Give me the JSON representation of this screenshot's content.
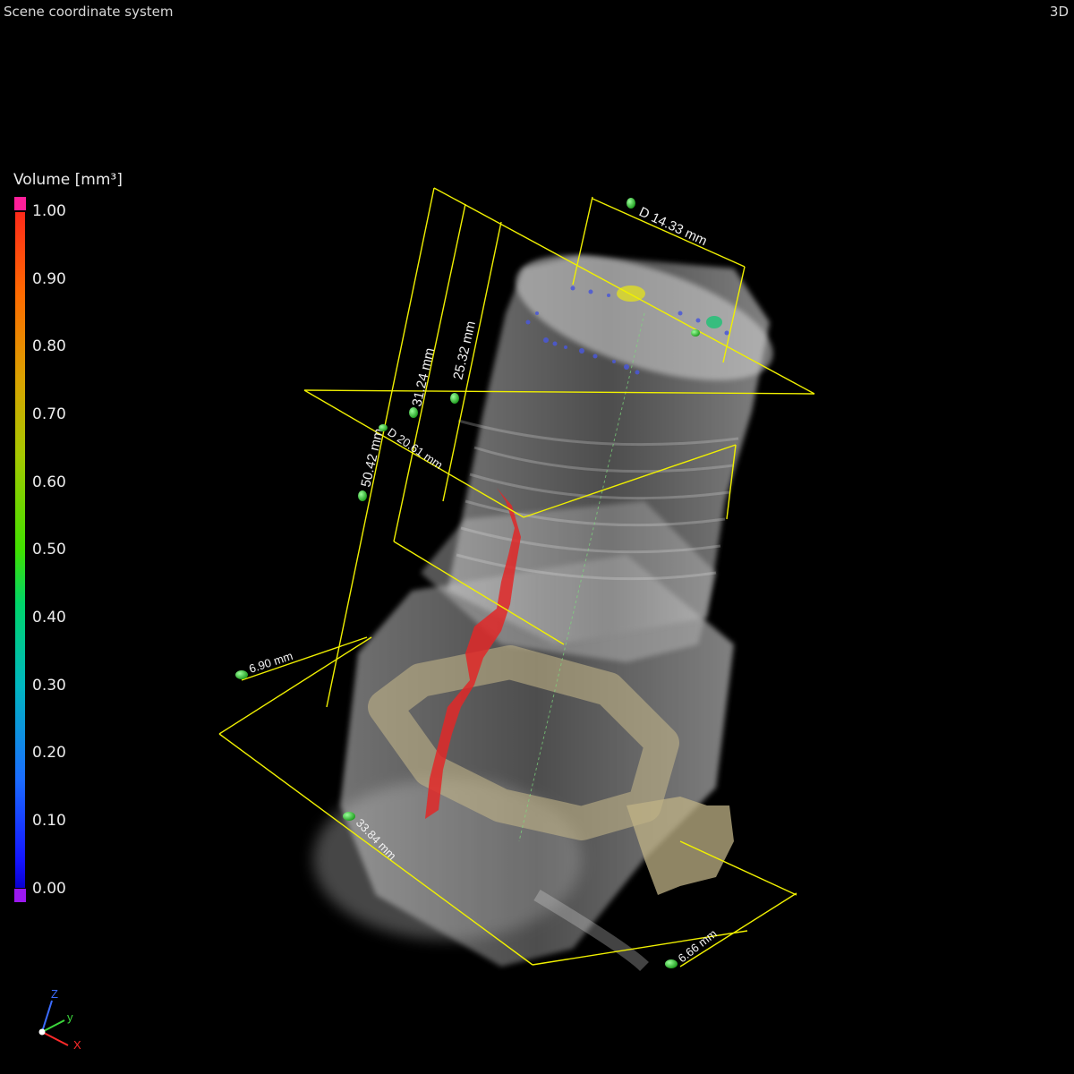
{
  "header": {
    "scene_title": "Scene coordinate system",
    "view_mode": "3D"
  },
  "legend": {
    "title": "Volume [mm³]",
    "ticks": [
      "1.00",
      "0.90",
      "0.80",
      "0.70",
      "0.60",
      "0.50",
      "0.40",
      "0.30",
      "0.20",
      "0.10",
      "0.00"
    ]
  },
  "measurements": {
    "diameter_top": "D 14.33 mm",
    "diameter_mid": "D 20.61 mm",
    "height_total": "50.42 mm",
    "height_mid": "31.24 mm",
    "height_upper": "25.32 mm",
    "width_small": "6.90 mm",
    "width_base": "33.84 mm",
    "clip_width": "6.66 mm"
  },
  "axes": {
    "z": "Z",
    "y": "y",
    "x": "X"
  },
  "colors": {
    "dimension_line": "#f0f000",
    "marker": "#27c227",
    "crack": "#e02828"
  }
}
